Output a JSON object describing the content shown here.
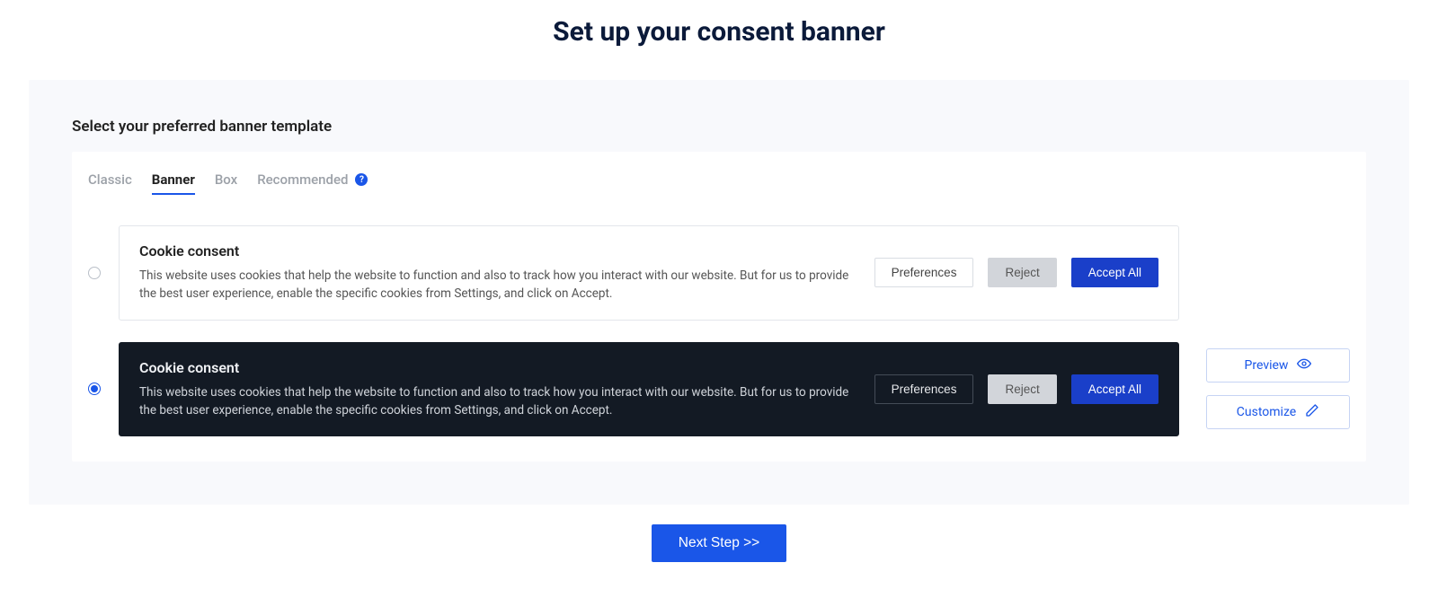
{
  "page": {
    "title": "Set up your consent banner",
    "section_label": "Select your preferred banner template",
    "tabs": {
      "classic": "Classic",
      "banner": "Banner",
      "box": "Box",
      "recommended": "Recommended"
    },
    "active_tab": "Banner",
    "help_glyph": "?"
  },
  "templates": [
    {
      "selected": false,
      "theme": "light",
      "title": "Cookie consent",
      "description": "This website uses cookies that help the website to function and also to track how you interact with our website. But for us to provide the best user experience, enable the specific cookies from Settings, and click on Accept.",
      "buttons": {
        "preferences": "Preferences",
        "reject": "Reject",
        "accept": "Accept All"
      }
    },
    {
      "selected": true,
      "theme": "dark",
      "title": "Cookie consent",
      "description": "This website uses cookies that help the website to function and also to track how you interact with our website. But for us to provide the best user experience, enable the specific cookies from Settings, and click on Accept.",
      "buttons": {
        "preferences": "Preferences",
        "reject": "Reject",
        "accept": "Accept All"
      }
    }
  ],
  "side": {
    "preview": "Preview",
    "customize": "Customize"
  },
  "next_button": "Next Step >>",
  "colors": {
    "primary": "#1a56e8",
    "accept": "#1a3fc9",
    "dark_panel": "#131a24",
    "muted_panel": "#f8f9fc"
  }
}
